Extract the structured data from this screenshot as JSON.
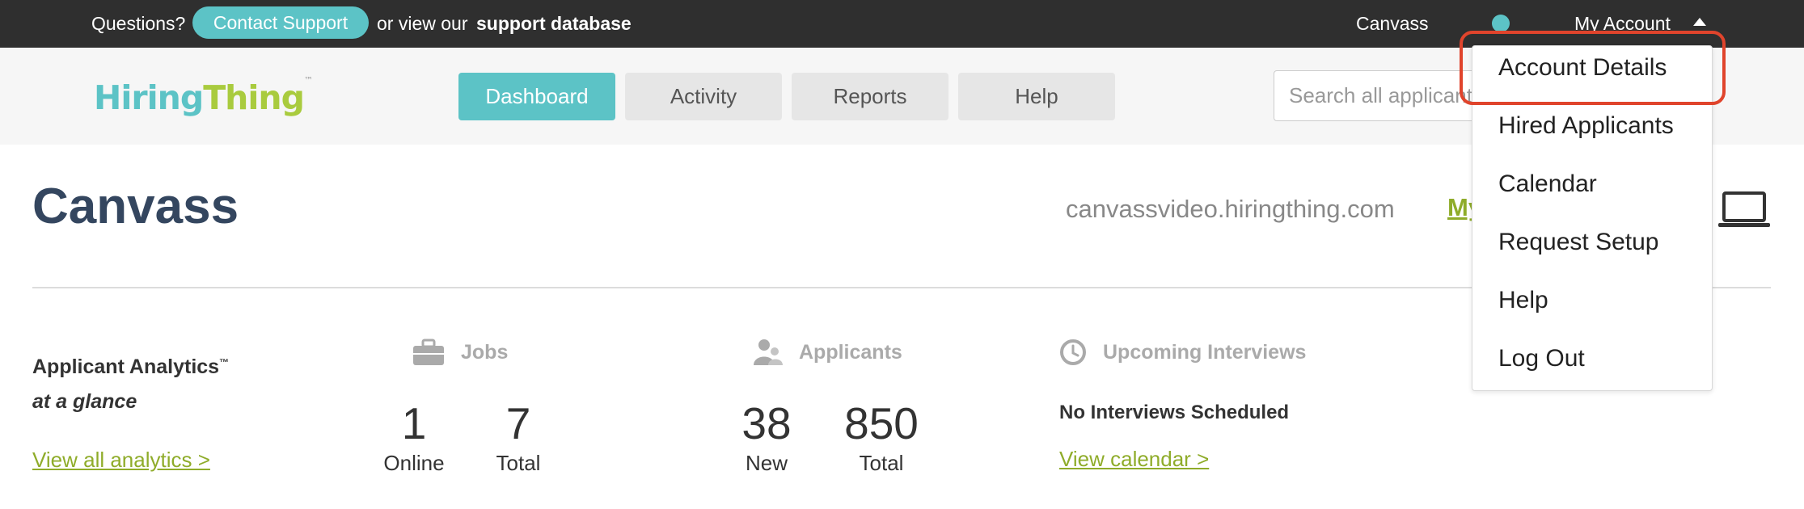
{
  "topbar": {
    "questions": "Questions?",
    "contact_support": "Contact Support",
    "view_our": "or view our",
    "support_database": "support database",
    "account_name": "Canvass",
    "my_account": "My Account"
  },
  "header": {
    "logo_part1": "Hiring",
    "logo_part2": "Thing",
    "logo_tm": "™",
    "nav": [
      "Dashboard",
      "Activity",
      "Reports",
      "Help"
    ],
    "search_placeholder": "Search all applicants"
  },
  "main": {
    "title": "Canvass",
    "domain": "canvassvideo.hiringthing.com",
    "my_link": "My"
  },
  "analytics": {
    "title": "Applicant Analytics",
    "tm": "™",
    "subtitle": "at a glance",
    "view_all": "View all analytics >"
  },
  "jobs": {
    "heading": "Jobs",
    "online_value": "1",
    "online_label": "Online",
    "total_value": "7",
    "total_label": "Total"
  },
  "applicants": {
    "heading": "Applicants",
    "new_value": "38",
    "new_label": "New",
    "total_value": "850",
    "total_label": "Total"
  },
  "interviews": {
    "heading": "Upcoming Interviews",
    "none": "No Interviews Scheduled",
    "view_calendar": "View calendar >"
  },
  "dropdown": {
    "items": [
      "Account Details",
      "Hired Applicants",
      "Calendar",
      "Request Setup",
      "Help",
      "Log Out"
    ]
  },
  "colors": {
    "teal": "#5cc3c6",
    "green": "#a9cb3e",
    "link_green": "#8fac2a",
    "title_navy": "#34465f",
    "highlight_red": "#e0442c"
  },
  "icons": [
    "briefcase-icon",
    "users-icon",
    "clock-icon",
    "laptop-icon",
    "caret-up-icon"
  ]
}
